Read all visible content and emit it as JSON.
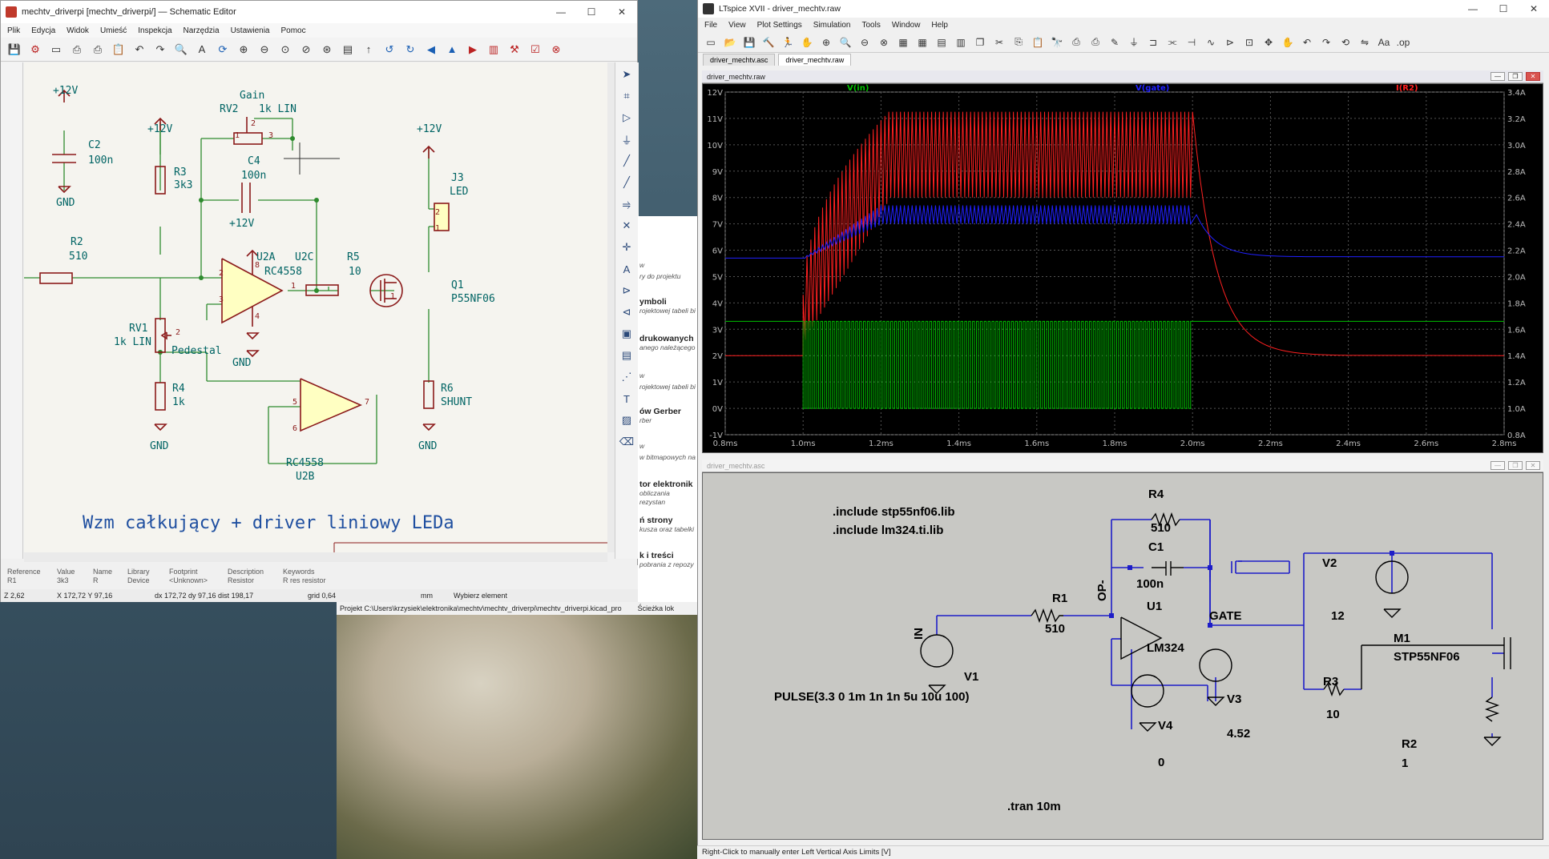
{
  "desktop": {
    "sea": "sea-and-cliff-wallpaper"
  },
  "kicad": {
    "title": "mechtv_driverpi [mechtv_driverpi/] — Schematic Editor",
    "menu": [
      "Plik",
      "Edycja",
      "Widok",
      "Umieść",
      "Inspekcja",
      "Narzędzia",
      "Ustawienia",
      "Pomoc"
    ],
    "schematic": {
      "c2": {
        "ref": "C2",
        "value": "100n",
        "supply": "+12V",
        "gnd": "GND"
      },
      "r3": {
        "ref": "R3",
        "value": "3k3",
        "supply": "+12V"
      },
      "rv2": {
        "ref": "RV2",
        "value": "1k LIN",
        "label": "Gain",
        "pin1": "1",
        "pin2": "2",
        "pin3": "3"
      },
      "c4": {
        "ref": "C4",
        "value": "100n"
      },
      "r2": {
        "ref": "R2",
        "value": "510"
      },
      "u2a": {
        "ref": "U2A",
        "value": "RC4558",
        "ref2": "U2C",
        "supply": "+12V",
        "gnd": "GND",
        "pin2": "2",
        "pin3": "3",
        "pin1": "1",
        "pin8": "8",
        "pin4": "4"
      },
      "r5": {
        "ref": "R5",
        "value": "10"
      },
      "q1": {
        "ref": "Q1",
        "value": "P55NF06",
        "pin1": "1"
      },
      "j3": {
        "ref": "J3",
        "value": "LED",
        "supply": "+12V",
        "pin2": "2",
        "pin1": "1"
      },
      "rv1": {
        "ref": "RV1",
        "value": "1k LIN",
        "label": "Pedestal",
        "pin2": "2"
      },
      "r4": {
        "ref": "R4",
        "value": "1k",
        "gnd": "GND"
      },
      "u2b": {
        "ref": "U2B",
        "value": "RC4558",
        "pin5": "5",
        "pin6": "6",
        "pin7": "7"
      },
      "r6": {
        "ref": "R6",
        "value": "SHUNT",
        "gnd": "GND"
      },
      "title_text": "Wzm całkujący + driver liniowy LEDa",
      "wire_color": "#2e8b2e",
      "comp_color": "#8b1a1a",
      "text_color": "#006464",
      "fill_color": "#ffffc2"
    },
    "props": {
      "headers": [
        "Reference",
        "Value",
        "Name",
        "Library",
        "Footprint",
        "Description",
        "Keywords"
      ],
      "values": [
        "R1",
        "3k3",
        "R",
        "Device",
        "<Unknown>",
        "Resistor",
        "R res resistor"
      ]
    },
    "status": {
      "zoom": "Z 2,62",
      "xy": "X 172,72  Y 97,16",
      "dxy": "dx 172,72  dy 97,16  dist 198,17",
      "grid": "grid 0,64",
      "units": "mm",
      "mode": "Wybierz element"
    },
    "project_path": "Projekt C:\\Users\\krzysiek\\elektronika\\mechtv\\mechtv_driverpi\\mechtv_driverpi.kicad_pro",
    "path_label": "Ścieżka lok",
    "manager_items": [
      {
        "bold": "",
        "sub": "w"
      },
      {
        "bold": "",
        "sub": "ry do projektu"
      },
      {
        "bold": "ymboli",
        "sub": "rojektowej tabeli bi"
      },
      {
        "bold": "drukowanych",
        "sub": "anego należącego"
      },
      {
        "bold": "",
        "sub": "w"
      },
      {
        "bold": "",
        "sub": "rojektowej tabeli bi"
      },
      {
        "bold": "ów Gerber",
        "sub": "rber"
      },
      {
        "bold": "",
        "sub": "w"
      },
      {
        "bold": "",
        "sub": "w bitmapowych na"
      },
      {
        "bold": "tor elektronik",
        "sub": "obliczania rezystan"
      },
      {
        "bold": "ń strony",
        "sub": "kusza oraz tabelki"
      },
      {
        "bold": "k i treści",
        "sub": "pobrania z repozy"
      }
    ]
  },
  "ltspice": {
    "title": "LTspice XVII - driver_mechtv.raw",
    "menu": [
      "File",
      "View",
      "Plot Settings",
      "Simulation",
      "Tools",
      "Window",
      "Help"
    ],
    "tabs": [
      "driver_mechtv.asc",
      "driver_mechtv.raw"
    ],
    "plot_title": "driver_mechtv.raw",
    "sch_title": "driver_mechtv.asc",
    "status": "Right-Click to manually enter Left Vertical Axis Limits [V]",
    "schematic": {
      "directives": [
        ".include stp55nf06.lib",
        ".include lm324.ti.lib"
      ],
      "tran": ".tran 10m",
      "r4": {
        "ref": "R4",
        "value": "510"
      },
      "c1": {
        "ref": "C1",
        "value": "100n"
      },
      "r1": {
        "ref": "R1",
        "value": "510"
      },
      "u1": {
        "ref": "U1",
        "value": "LM324"
      },
      "v2": {
        "ref": "V2",
        "value": "12"
      },
      "v1": {
        "ref": "V1",
        "value": "PULSE(3.3 0 1m 1n 1n 5u 10u 100)"
      },
      "v3": {
        "ref": "V3",
        "value": "4.52"
      },
      "v4": {
        "ref": "V4",
        "value": "0"
      },
      "r3": {
        "ref": "R3",
        "value": "10"
      },
      "m1": {
        "ref": "M1",
        "value": "STP55NF06"
      },
      "r2": {
        "ref": "R2",
        "value": "1"
      },
      "net_in": "IN",
      "net_gate": "GATE",
      "net_op": "OP-"
    }
  },
  "chart_data": {
    "type": "line",
    "series": [
      {
        "name": "V(in)",
        "color": "#00c000",
        "axis": "left"
      },
      {
        "name": "V(gate)",
        "color": "#2020ff",
        "axis": "left"
      },
      {
        "name": "I(R2)",
        "color": "#ff2020",
        "axis": "right"
      }
    ],
    "x_ticks": [
      "0.8ms",
      "1.0ms",
      "1.2ms",
      "1.4ms",
      "1.6ms",
      "1.8ms",
      "2.0ms",
      "2.2ms",
      "2.4ms",
      "2.6ms",
      "2.8ms"
    ],
    "y_left_ticks": [
      "12V",
      "11V",
      "10V",
      "9V",
      "8V",
      "7V",
      "6V",
      "5V",
      "4V",
      "3V",
      "2V",
      "1V",
      "0V",
      "-1V"
    ],
    "y_right_ticks": [
      "3.4A",
      "3.2A",
      "3.0A",
      "2.8A",
      "2.6A",
      "2.4A",
      "2.2A",
      "2.0A",
      "1.8A",
      "1.6A",
      "1.4A",
      "1.2A",
      "1.0A",
      "0.8A"
    ],
    "xlim": [
      0.8,
      2.8
    ],
    "ylim_left": [
      -1,
      12
    ],
    "ylim_right": [
      0.8,
      3.4
    ],
    "vin": {
      "high": 3.3,
      "low": 0,
      "pulse_start": 1.0,
      "pulse_end": 2.0
    },
    "gate": {
      "before": 5.7,
      "plateau_low": 7.0,
      "plateau_high": 7.7,
      "after": 5.75
    },
    "ir2": {
      "before": 1.4,
      "low": 2.6,
      "high": 3.25,
      "after": 1.4
    },
    "grid": true
  }
}
